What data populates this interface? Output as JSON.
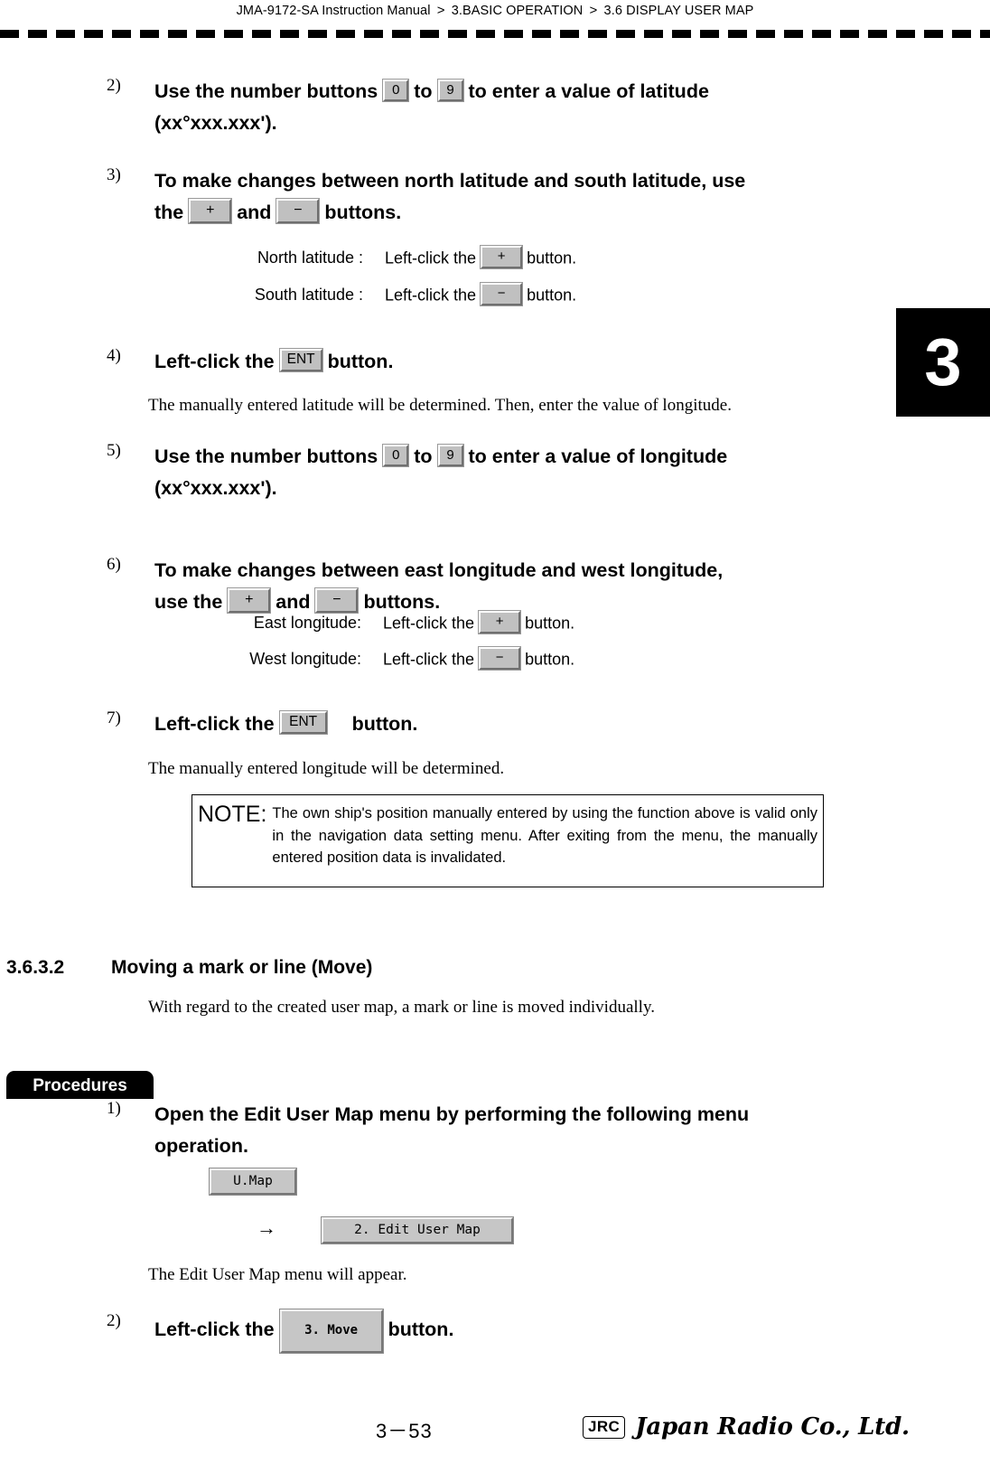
{
  "header": {
    "manual": "JMA-9172-SA Instruction Manual",
    "sep": ">",
    "chapter": "3.BASIC OPERATION",
    "section": "3.6  DISPLAY USER MAP"
  },
  "chapter_tab": {
    "number": "3"
  },
  "steps": {
    "s2": {
      "num": "2)",
      "text_a": "Use the number buttons",
      "key_0": "0",
      "text_b": "to",
      "key_9": "9",
      "text_c": "to enter a value of latitude",
      "text_d": "(xx°xxx.xxx')."
    },
    "s3": {
      "num": "3)",
      "text_a": "To make changes between north latitude and south latitude, use",
      "text_b": "the",
      "key_plus": "+",
      "text_c": "and",
      "key_minus": "−",
      "text_d": "buttons.",
      "sub1_label": "North latitude :",
      "sub1_text": "Left-click the",
      "sub1_key": "+",
      "sub1_tail": "button.",
      "sub2_label": "South latitude :",
      "sub2_text": "Left-click the",
      "sub2_key": "−",
      "sub2_tail": "button."
    },
    "s4": {
      "num": "4)",
      "text_a": "Left-click the",
      "key_ent": "ENT",
      "text_b": "button.",
      "para": "The manually entered latitude will be determined. Then, enter the value of longitude."
    },
    "s5": {
      "num": "5)",
      "text_a": "Use the number buttons",
      "key_0": "0",
      "text_b": "to",
      "key_9": "9",
      "text_c": "to enter a value of longitude",
      "text_d": "(xx°xxx.xxx')."
    },
    "s6": {
      "num": "6)",
      "text_a": "To make changes between east longitude and west longitude,",
      "text_b": "use the",
      "key_plus": "+",
      "text_c": "and",
      "key_minus": "−",
      "text_d": "buttons.",
      "sub1_label": "East longitude:",
      "sub1_text": "Left-click the",
      "sub1_key": "+",
      "sub1_tail": "button.",
      "sub2_label": "West longitude:",
      "sub2_text": "Left-click the",
      "sub2_key": "−",
      "sub2_tail": "button."
    },
    "s7": {
      "num": "7)",
      "text_a": "Left-click the",
      "key_ent": "ENT",
      "text_b": "button.",
      "para": "The manually entered longitude will be determined."
    }
  },
  "note": {
    "label": "NOTE:",
    "text": "The own ship's position manually entered by using the function above is valid only in the navigation data setting menu. After exiting from the menu, the manually entered position data is invalidated."
  },
  "section": {
    "number": "3.6.3.2",
    "title": "Moving a mark or line (Move)",
    "intro": "With regard to the created user map, a mark or line is moved individually."
  },
  "procedures": {
    "tag": "Procedures",
    "p1": {
      "num": "1)",
      "text_a": "Open the Edit User Map menu by performing the following menu",
      "text_b": "operation.",
      "key_umap": "U.Map",
      "arrow": "→",
      "key_edit": "2. Edit User Map",
      "para": "The Edit User Map menu will appear."
    },
    "p2": {
      "num": "2)",
      "text_a": "Left-click the",
      "key_move": "3. Move",
      "text_b": "button."
    }
  },
  "footer": {
    "page": "3－53",
    "logo_mark": "JRC",
    "logo_name": "Japan Radio Co., Ltd."
  }
}
